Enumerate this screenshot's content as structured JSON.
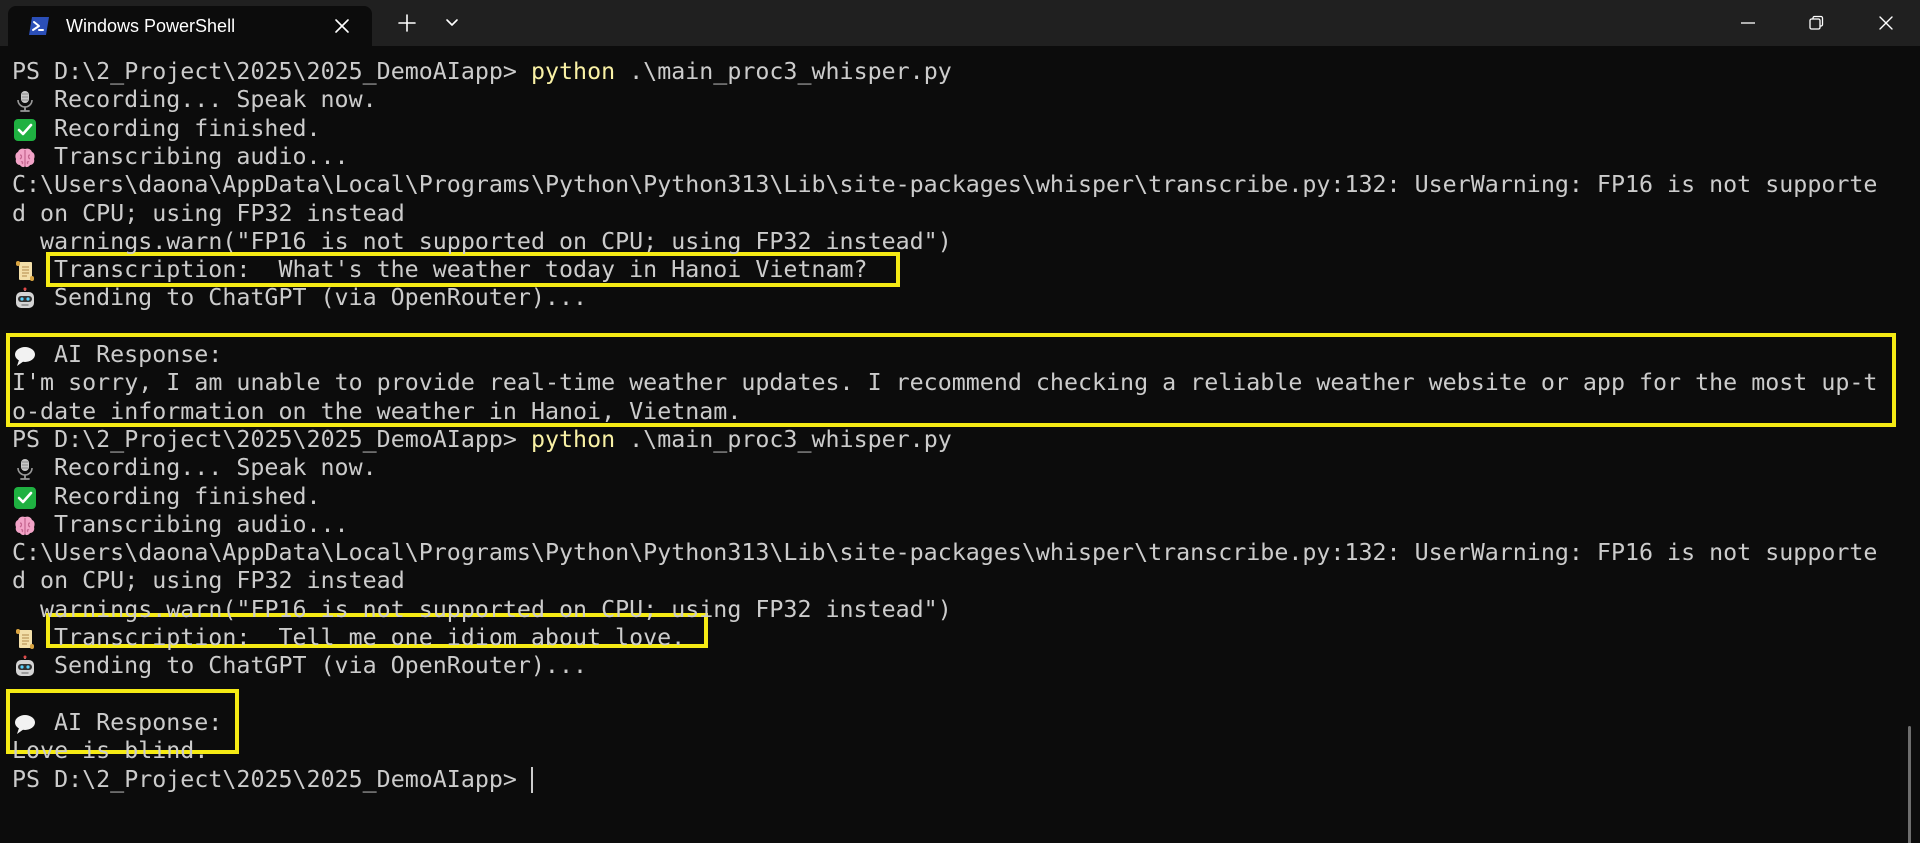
{
  "window": {
    "tab_title": "Windows PowerShell"
  },
  "terminal": {
    "lines": [
      {
        "text": "PS D:\\2_Project\\2025\\2025_DemoAIapp> ",
        "cmd": "python",
        "args": " .\\main_proc3_whisper.py"
      },
      {
        "icon": "microphone-icon",
        "text": " Recording... Speak now."
      },
      {
        "icon": "check-mark-icon",
        "text": " Recording finished."
      },
      {
        "icon": "brain-icon",
        "text": " Transcribing audio..."
      },
      {
        "text": "C:\\Users\\daona\\AppData\\Local\\Programs\\Python\\Python313\\Lib\\site-packages\\whisper\\transcribe.py:132: UserWarning: FP16 is not supporte"
      },
      {
        "text": "d on CPU; using FP32 instead"
      },
      {
        "text": "  warnings.warn(\"FP16 is not supported on CPU; using FP32 instead\")"
      },
      {
        "icon": "scroll-icon",
        "text": " Transcription:  What's the weather today in Hanoi Vietnam?"
      },
      {
        "icon": "robot-icon",
        "text": " Sending to ChatGPT (via OpenRouter)..."
      },
      {
        "text": ""
      },
      {
        "icon": "speech-bubble-icon",
        "text": " AI Response:"
      },
      {
        "text": "I'm sorry, I am unable to provide real-time weather updates. I recommend checking a reliable weather website or app for the most up-t"
      },
      {
        "text": "o-date information on the weather in Hanoi, Vietnam."
      },
      {
        "text": "PS D:\\2_Project\\2025\\2025_DemoAIapp> ",
        "cmd": "python",
        "args": " .\\main_proc3_whisper.py"
      },
      {
        "icon": "microphone-icon",
        "text": " Recording... Speak now."
      },
      {
        "icon": "check-mark-icon",
        "text": " Recording finished."
      },
      {
        "icon": "brain-icon",
        "text": " Transcribing audio..."
      },
      {
        "text": "C:\\Users\\daona\\AppData\\Local\\Programs\\Python\\Python313\\Lib\\site-packages\\whisper\\transcribe.py:132: UserWarning: FP16 is not supporte"
      },
      {
        "text": "d on CPU; using FP32 instead"
      },
      {
        "text": "  warnings.warn(\"FP16 is not supported on CPU; using FP32 instead\")"
      },
      {
        "icon": "scroll-icon",
        "text": " Transcription:  Tell me one idiom about love."
      },
      {
        "icon": "robot-icon",
        "text": " Sending to ChatGPT (via OpenRouter)..."
      },
      {
        "text": ""
      },
      {
        "icon": "speech-bubble-icon",
        "text": " AI Response:"
      },
      {
        "text": "Love is blind."
      },
      {
        "text": "PS D:\\2_Project\\2025\\2025_DemoAIapp> ",
        "cursor": true
      }
    ]
  },
  "colors": {
    "background": "#0c0c0c",
    "titlebar": "#202020",
    "text": "#cccccc",
    "command": "#f9f1a5",
    "highlight": "#f5ea14",
    "powershell_icon": "#2b4fb8"
  }
}
